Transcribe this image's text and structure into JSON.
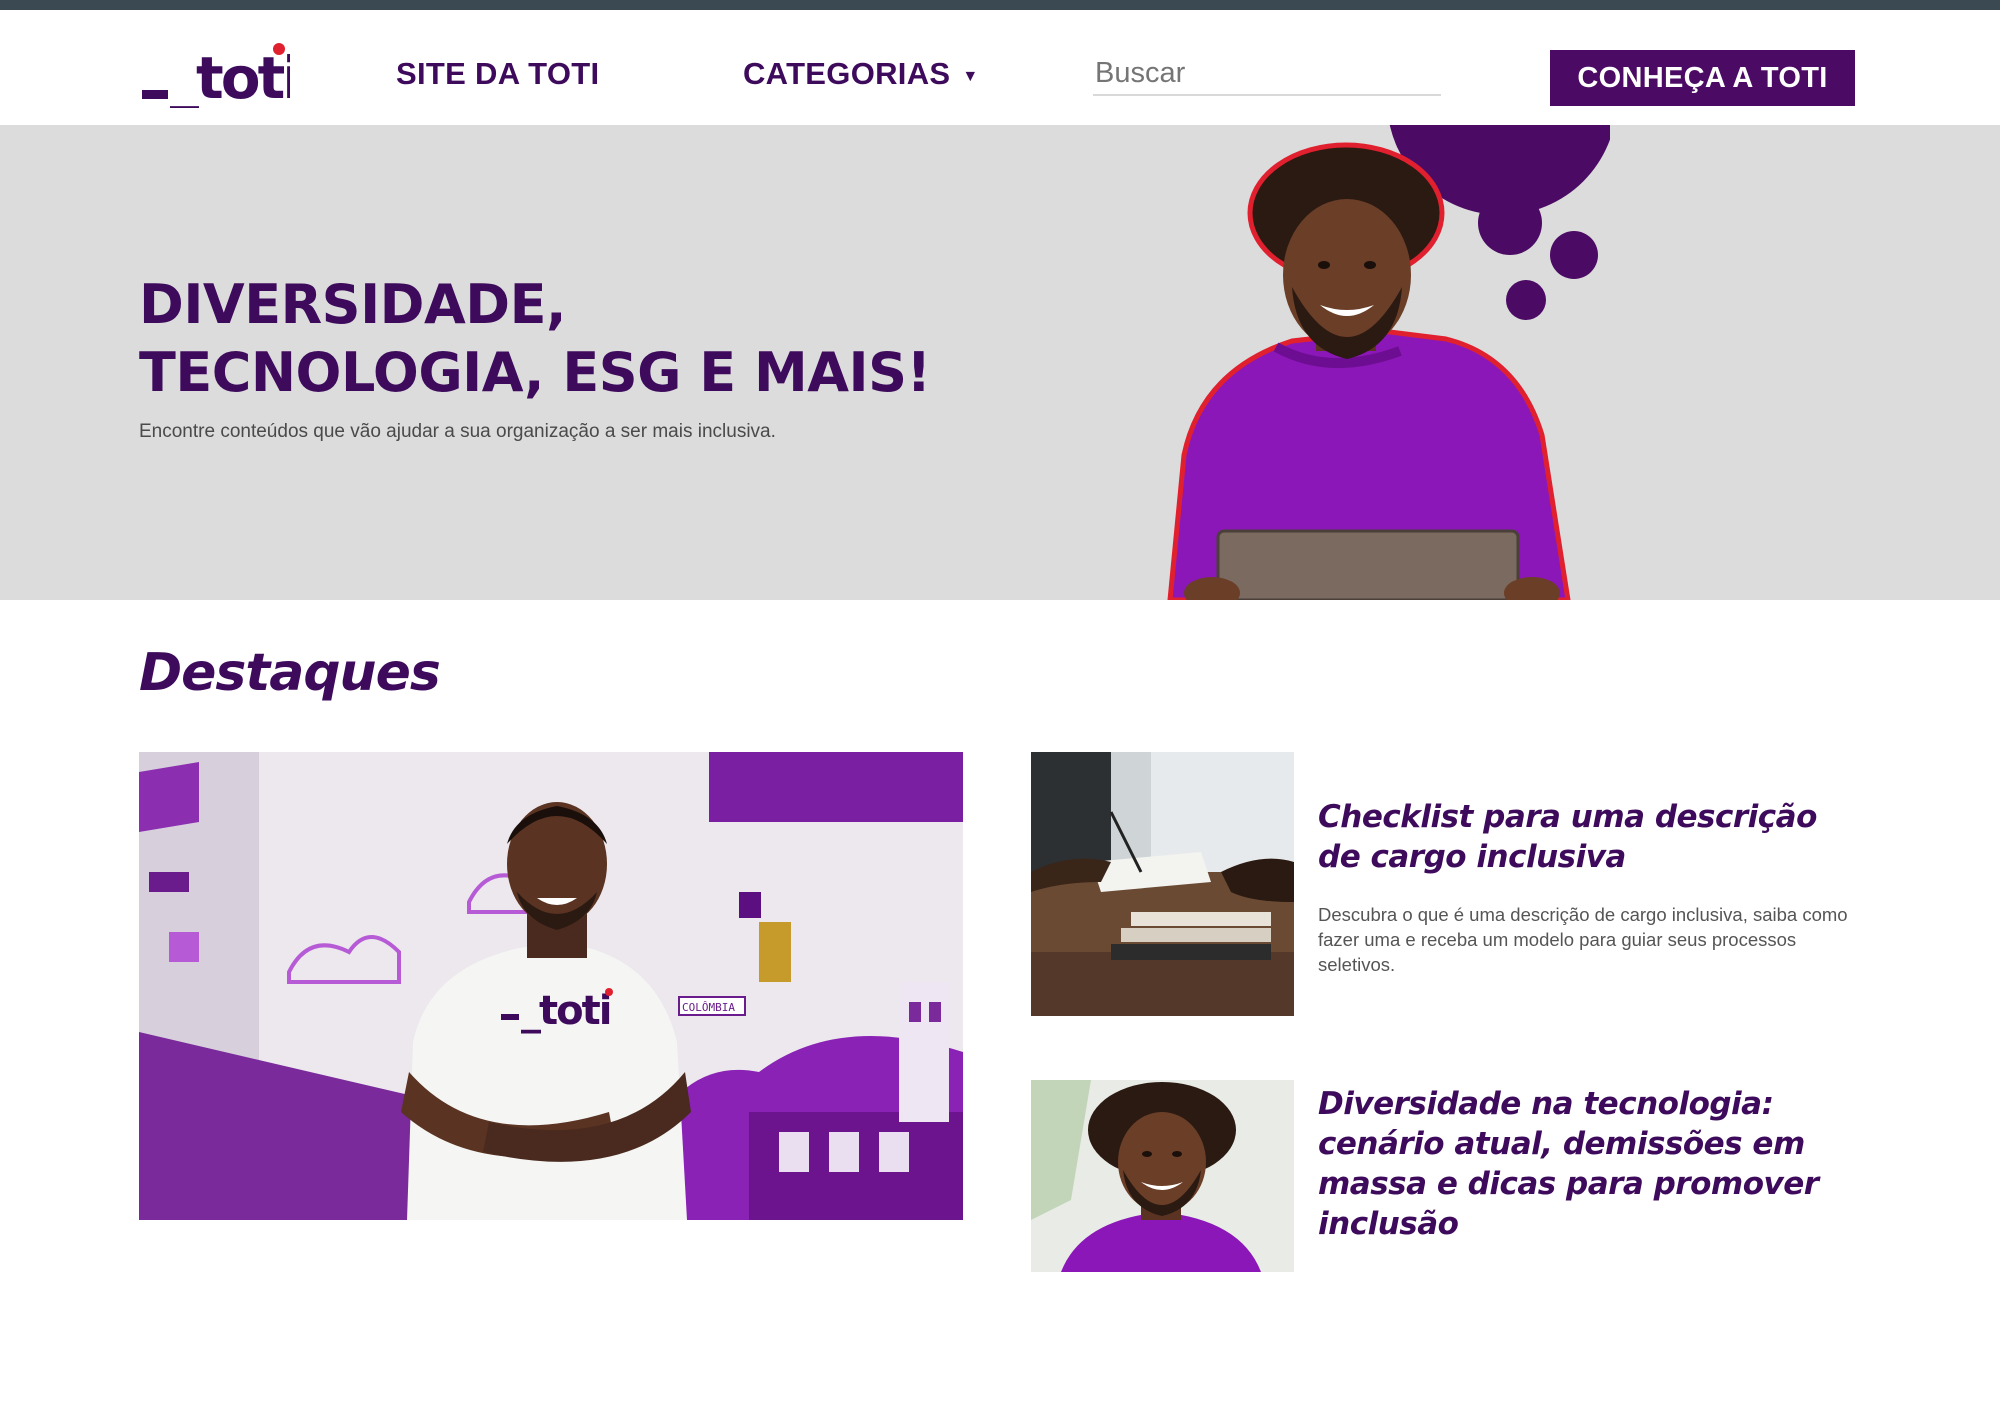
{
  "header": {
    "logo_text": "_toti",
    "nav_site": "SITE DA TOTI",
    "nav_categories": "CATEGORIAS",
    "search_placeholder": "Buscar",
    "cta_label": "CONHEÇA A TOTI"
  },
  "hero": {
    "title_line1": "DIVERSIDADE,",
    "title_line2": "TECNOLOGIA, ESG E MAIS!",
    "subtitle": "Encontre conteúdos que vão ajudar a sua organização a ser mais inclusiva."
  },
  "highlights": {
    "title": "Destaques",
    "featured_shirt_text": "_toti",
    "featured_sign_text": "COLÔMBIA",
    "cards": [
      {
        "title": "Checklist para uma descrição de cargo inclusiva",
        "description": "Descubra o que é uma descrição de cargo inclusiva, saiba como fazer uma e receba um modelo para guiar seus processos seletivos."
      },
      {
        "title": "Diversidade na tecnologia: cenário atual, demissões em massa e dicas para promover inclusão"
      }
    ]
  },
  "colors": {
    "brand_purple": "#3d0a5c",
    "button_purple": "#4b0a63",
    "logo_dot_red": "#e0202e",
    "hero_bg": "#dcdcdc"
  }
}
